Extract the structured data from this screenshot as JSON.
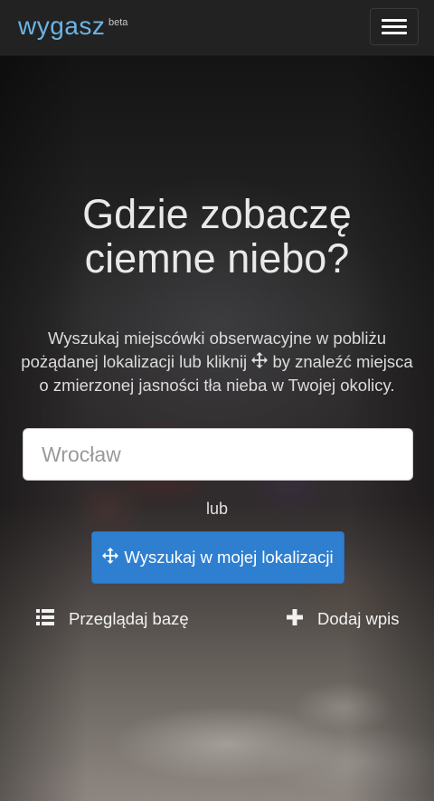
{
  "navbar": {
    "brand": "wygasz",
    "brand_badge": "beta",
    "menu_icon": "hamburger-icon"
  },
  "hero": {
    "title_line1": "Gdzie zobaczę",
    "title_line2": "ciemne niebo?",
    "description_part1": "Wyszukaj miejscówki obserwacyjne w pobliżu pożądanej lokalizacji lub kliknij",
    "description_icon": "move-icon",
    "description_part2": "by znaleźć miejsca o zmierzonej jasności tła nieba w Twojej okolicy."
  },
  "search": {
    "placeholder": "Wrocław",
    "value": ""
  },
  "or_label": "lub",
  "locate_button": {
    "icon": "move-icon",
    "label": "Wyszukaj w mojej lokalizacji",
    "color": "#2f7fd0"
  },
  "links": {
    "browse": {
      "icon": "list-icon",
      "label": "Przeglądaj bazę"
    },
    "add": {
      "icon": "plus-icon",
      "label": "Dodaj wpis"
    }
  },
  "colors": {
    "navbar_bg": "#222222",
    "brand": "#6cb4e4",
    "accent": "#2f7fd0"
  }
}
